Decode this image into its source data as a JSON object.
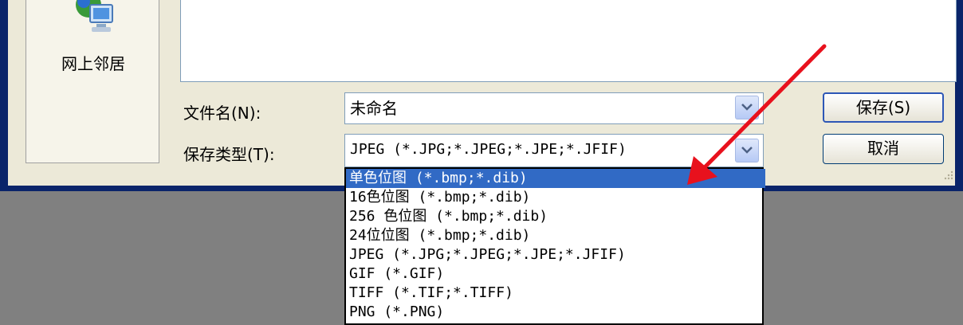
{
  "places_bar": {
    "network_label": "网上邻居"
  },
  "filename": {
    "label": "文件名(N):",
    "value": "未命名"
  },
  "filetype": {
    "label": "保存类型(T):",
    "value": "JPEG (*.JPG;*.JPEG;*.JPE;*.JFIF)"
  },
  "buttons": {
    "save": "保存(S)",
    "cancel": "取消"
  },
  "dropdown": {
    "selected_index": 0,
    "options": [
      "单色位图 (*.bmp;*.dib)",
      "16色位图 (*.bmp;*.dib)",
      "256 色位图 (*.bmp;*.dib)",
      "24位位图 (*.bmp;*.dib)",
      "JPEG (*.JPG;*.JPEG;*.JPE;*.JFIF)",
      "GIF (*.GIF)",
      "TIFF (*.TIF;*.TIFF)",
      "PNG (*.PNG)"
    ]
  },
  "colors": {
    "selection": "#316ac5",
    "annotation_arrow": "#e8111d",
    "title_blue": "#0a246a"
  },
  "icons": {
    "network": "network-places-icon",
    "combo": "chevron-down-icon",
    "grip": "resize-grip-icon",
    "annotation": "red-arrow-icon"
  }
}
